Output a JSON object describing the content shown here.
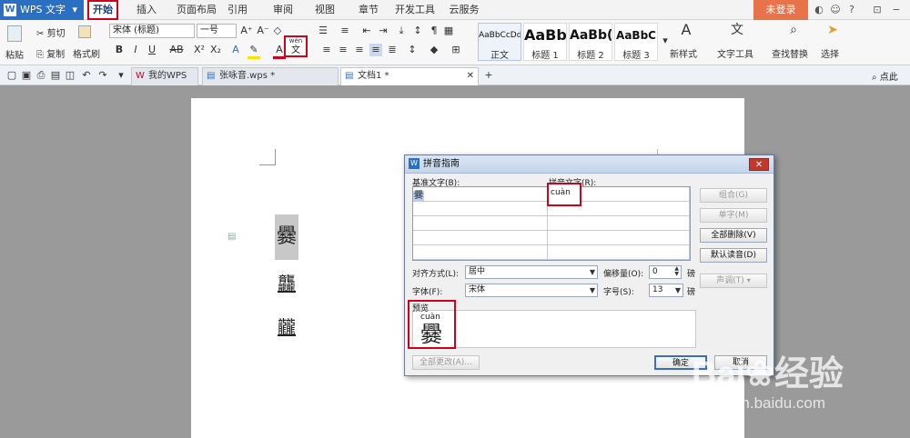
{
  "app": {
    "title": "WPS 文字",
    "logo": "W",
    "dropdown_glyph": "▾"
  },
  "menu_tabs": [
    "开始",
    "插入",
    "页面布局",
    "引用",
    "审阅",
    "视图",
    "章节",
    "开发工具",
    "云服务"
  ],
  "login_label": "未登录",
  "ribbon": {
    "paste": "粘贴",
    "cut": "剪切",
    "copy": "复制",
    "format_painter": "格式刷",
    "font_name": "宋体 (标题)",
    "font_size": "一号",
    "pinyin_glyph": "wén",
    "styles": [
      {
        "preview": "AaBbCcDd",
        "name": "正文"
      },
      {
        "preview": "AaBb",
        "name": "标题 1"
      },
      {
        "preview": "AaBb(",
        "name": "标题 2"
      },
      {
        "preview": "AaBbC",
        "name": "标题 3"
      }
    ],
    "new_style": "新样式",
    "text_tools": "文字工具",
    "find_replace": "查找替换",
    "select": "选择"
  },
  "doc_tabs": [
    {
      "label": "我的WPS"
    },
    {
      "label": "张咏音.wps *"
    },
    {
      "label": "文档1 *"
    }
  ],
  "right_corner": "点此",
  "document": {
    "chars": [
      "爨",
      "龘",
      "龖"
    ]
  },
  "dialog": {
    "title": "拼音指南",
    "close_glyph": "✕",
    "base_text_label": "基准文字(B):",
    "ruby_text_label": "拼音文字(R):",
    "base_char": "爨",
    "ruby_value": "cuàn",
    "buttons": {
      "group": "组合(G)",
      "single": "单字(M)",
      "delete_all": "全部删除(V)",
      "default_reading": "默认读音(D)",
      "tone": "声调(T)",
      "change_all": "全部更改(A)...",
      "ok": "确定",
      "cancel": "取消"
    },
    "align_label": "对齐方式(L):",
    "align_value": "居中",
    "offset_label": "偏移量(O):",
    "offset_value": "0",
    "offset_unit": "磅",
    "font_label": "字体(F):",
    "font_value": "宋体",
    "size_label": "字号(S):",
    "size_value": "13",
    "size_unit": "磅",
    "preview_label": "预览",
    "preview_ruby": "cuàn",
    "preview_char": "爨"
  },
  "watermark": {
    "brand": "Bai",
    "brand_tail": "经验",
    "url": "jingyan.baidu.com"
  },
  "colors": {
    "brand_blue": "#2b6fc2",
    "highlight_red": "#d0021b",
    "login_orange": "#e8724a"
  }
}
